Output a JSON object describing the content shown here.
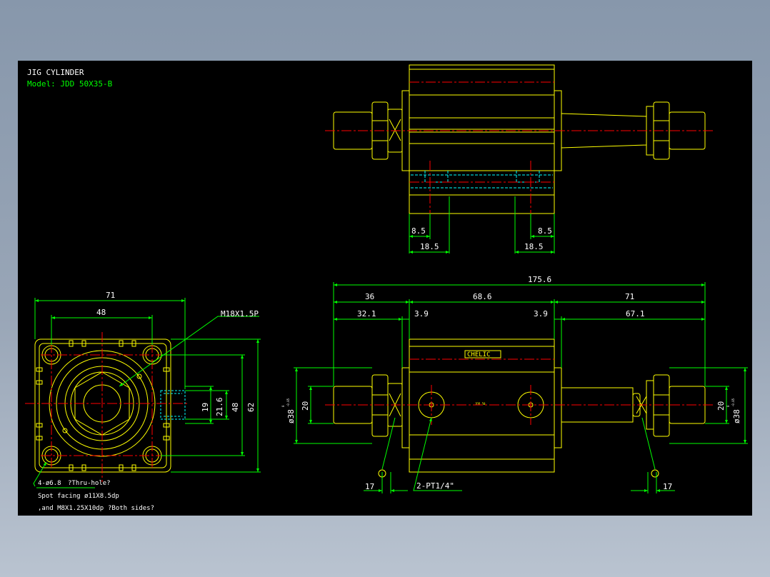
{
  "title_block": {
    "title": "JIG CYLINDER",
    "model": "Model:  JDD 50X35-B"
  },
  "front_view": {
    "dim_71": "71",
    "dim_48": "48",
    "dim_19": "19",
    "dim_21_6": "21.6",
    "dim_48_v": "48",
    "dim_62": "62",
    "thread_callout": "M18X1.5P",
    "hole_count": "4-ø6.8",
    "thru_hole": "?Thru-hole?",
    "spot_facing": "Spot facing  ø11X8.5dp",
    "m8_tap": ",and M8X1.25X10dp",
    "both_sides": "?Both sides?"
  },
  "top_view": {
    "dim_8_5_left": "8.5",
    "dim_8_5_right": "8.5",
    "dim_18_5_left": "18.5",
    "dim_18_5_right": "18.5"
  },
  "side_view": {
    "dim_175_6": "175.6",
    "dim_36": "36",
    "dim_68_6": "68.6",
    "dim_71": "71",
    "dim_32_1": "32.1",
    "dim_3_9_left": "3.9",
    "dim_3_9_right": "3.9",
    "dim_67_1": "67.1",
    "dim_20_left": "20",
    "dim_20_right": "20",
    "dia_38_left": "ø38",
    "dia_38_right": "ø38",
    "tol_upper": "0",
    "tol_lower": "-0.05",
    "dim_17_left": "17",
    "dim_17_right": "17",
    "port_callout": "2-PT1/4\"",
    "brand_label": "CHELIC",
    "body_mark": "JDD 50"
  },
  "colors": {
    "outline": "#ffff00",
    "dimension": "#00ff00",
    "centerline": "#ff0000",
    "hidden": "#00ffff",
    "text": "#ffffff",
    "model_text": "#00ff00",
    "background": "#000000"
  }
}
